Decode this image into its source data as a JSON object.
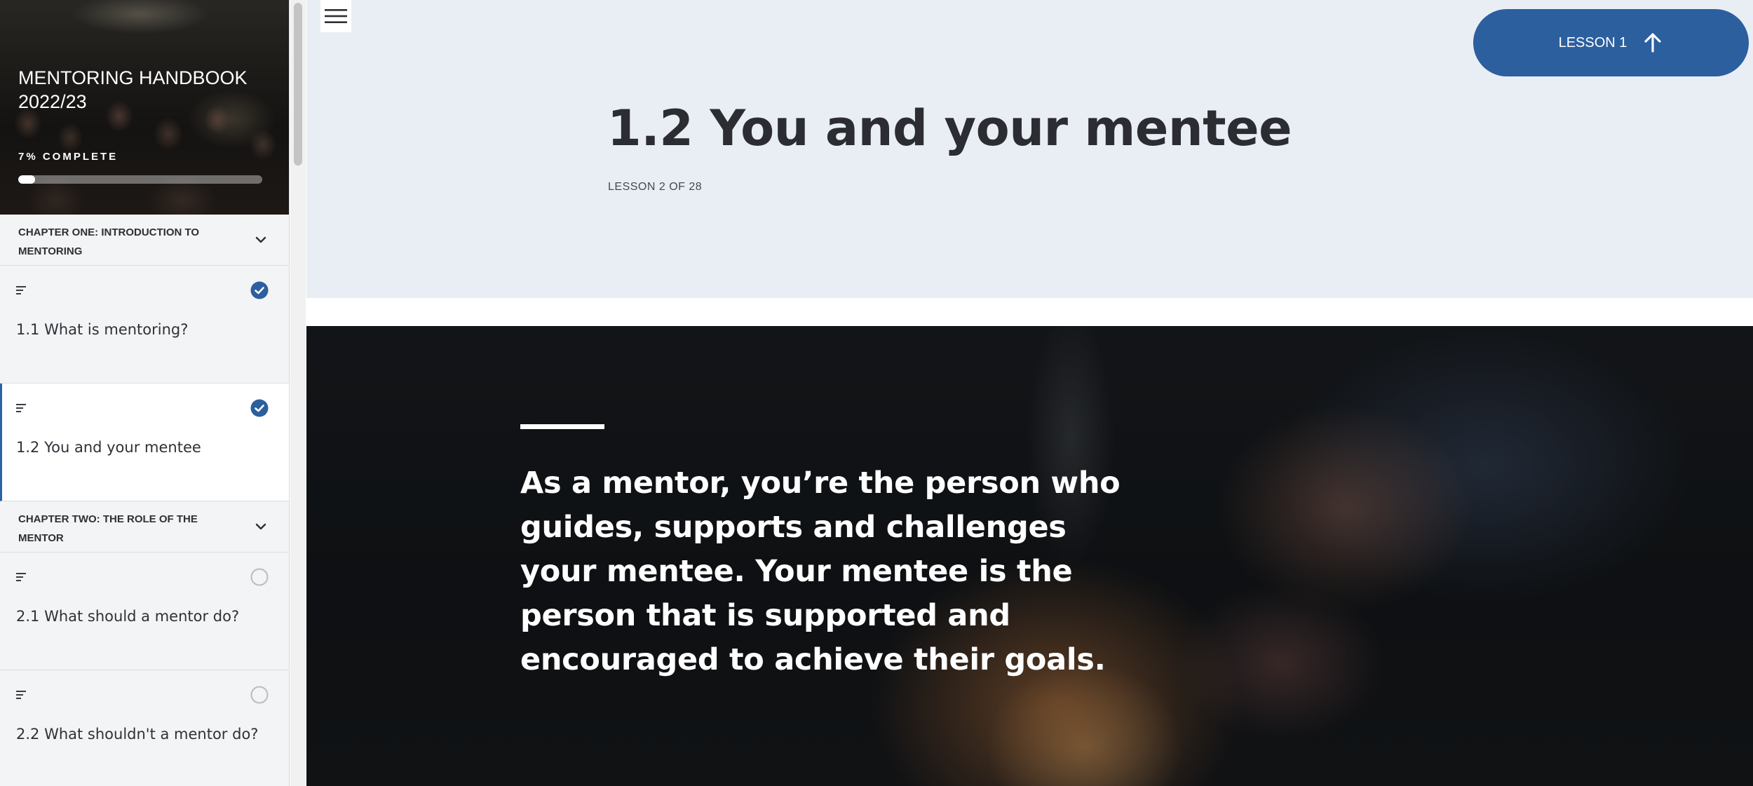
{
  "sidebar": {
    "course_title": "MENTORING HANDBOOK 2022/23",
    "progress_label": "7% COMPLETE",
    "progress_fraction": 0.07,
    "chapters": [
      {
        "label": "CHAPTER ONE: INTRODUCTION TO MENTORING",
        "lessons": [
          {
            "title": "1.1 What is mentoring?",
            "status": "complete"
          },
          {
            "title": "1.2 You and your mentee",
            "status": "complete",
            "active": true
          }
        ]
      },
      {
        "label": "CHAPTER TWO: THE ROLE OF THE MENTOR",
        "lessons": [
          {
            "title": "2.1 What should a mentor do?",
            "status": "incomplete"
          },
          {
            "title": "2.2 What shouldn't a mentor do?",
            "status": "incomplete"
          }
        ]
      }
    ]
  },
  "header": {
    "nav_button_label": "LESSON 1",
    "lesson_title": "1.2 You and your mentee",
    "lesson_count": "LESSON 2 OF 28"
  },
  "quote": {
    "text": "As a mentor, you’re the person who guides, supports and challenges your mentee. Your mentee is the person that is supported and encouraged to achieve their goals."
  },
  "colors": {
    "accent": "#2c5f9e",
    "header_background": "#e9eef5",
    "sidebar_background": "#f3f4f5"
  },
  "icons": {
    "menu": "hamburger-icon",
    "nav_arrow": "arrow-up-icon",
    "chapter_toggle": "chevron-down-icon",
    "lesson_type": "text-lines-icon",
    "complete": "check-circle-icon",
    "incomplete": "empty-circle-icon"
  }
}
